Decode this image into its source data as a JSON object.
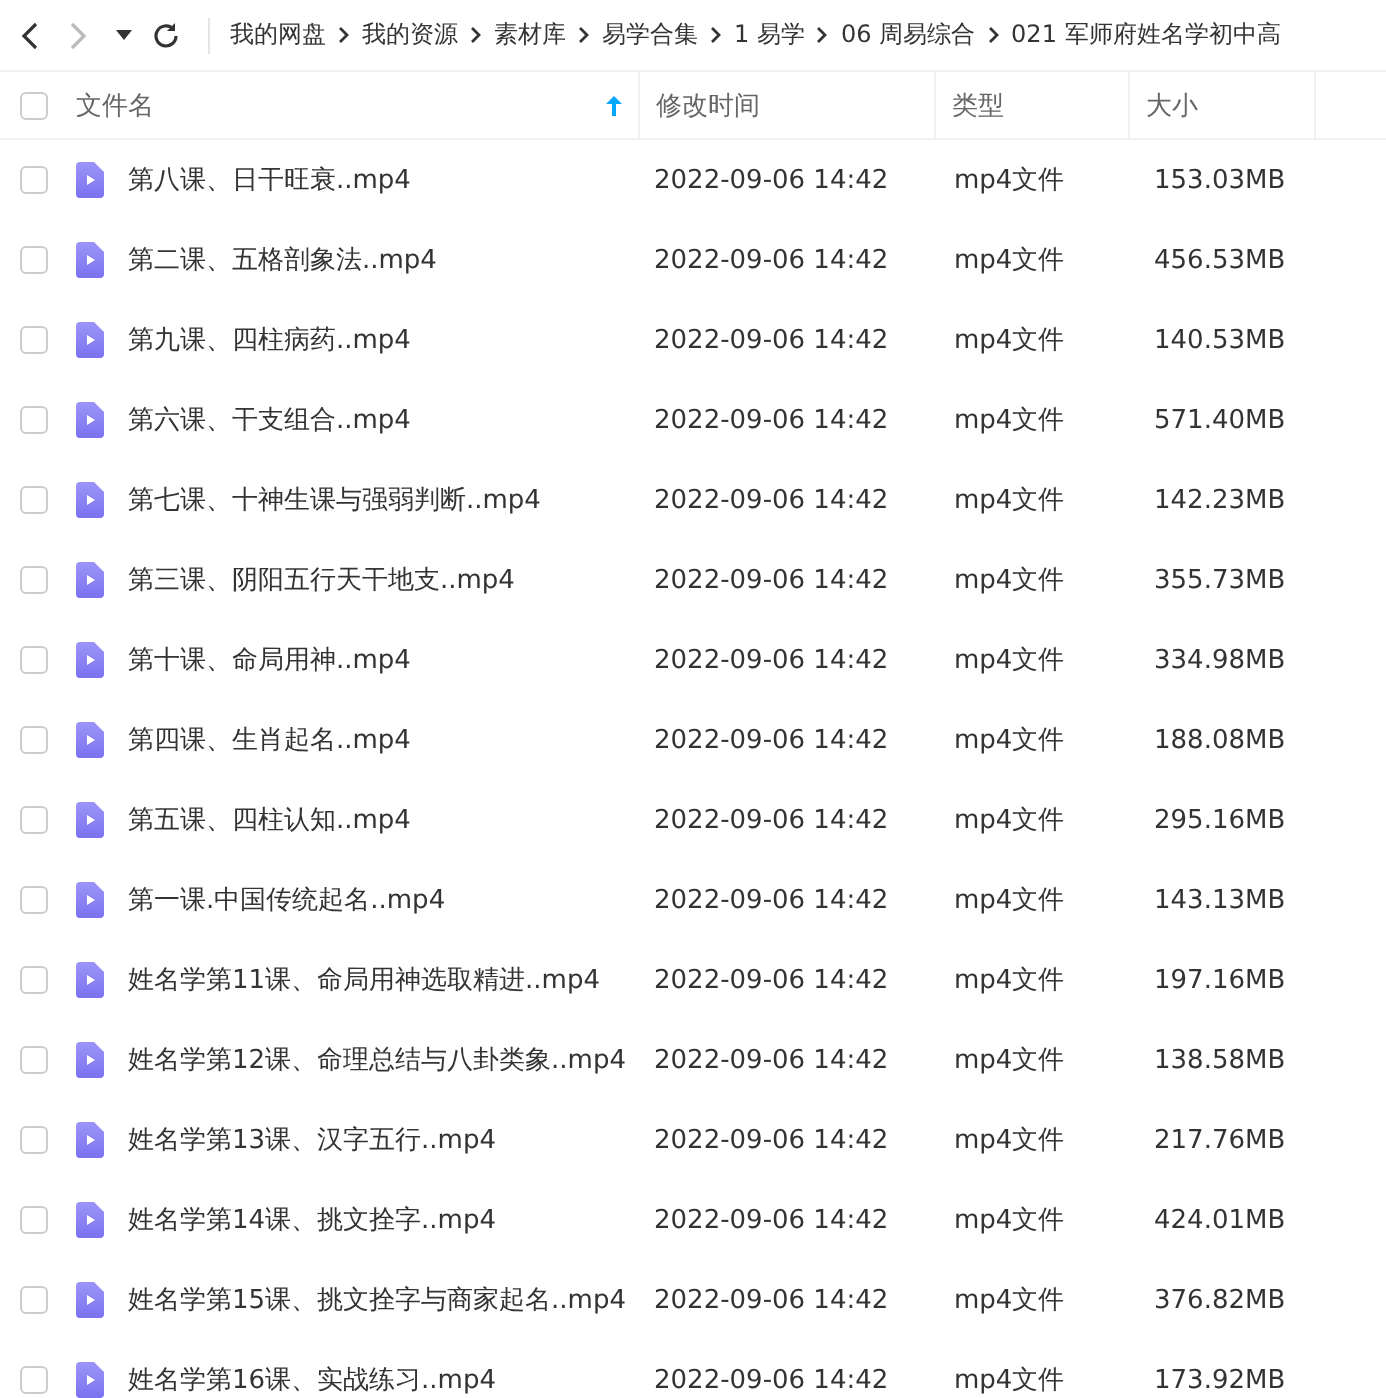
{
  "toolbar": {
    "breadcrumb": [
      "我的网盘",
      "我的资源",
      "素材库",
      "易学合集",
      "1 易学",
      "06 周易综合",
      "021 军师府姓名学初中高"
    ]
  },
  "table": {
    "all_checked": false,
    "columns": [
      {
        "label": "文件名",
        "sorted": true
      },
      {
        "label": "修改时间",
        "sorted": false
      },
      {
        "label": "类型",
        "sorted": false
      },
      {
        "label": "大小",
        "sorted": false
      }
    ],
    "rows": [
      {
        "name": "第八课、日干旺衰..mp4",
        "modified": "2022-09-06 14:42",
        "type": "mp4文件",
        "size": "153.03MB",
        "checked": false
      },
      {
        "name": "第二课、五格剖象法..mp4",
        "modified": "2022-09-06 14:42",
        "type": "mp4文件",
        "size": "456.53MB",
        "checked": false
      },
      {
        "name": "第九课、四柱病药..mp4",
        "modified": "2022-09-06 14:42",
        "type": "mp4文件",
        "size": "140.53MB",
        "checked": false
      },
      {
        "name": "第六课、干支组合..mp4",
        "modified": "2022-09-06 14:42",
        "type": "mp4文件",
        "size": "571.40MB",
        "checked": false
      },
      {
        "name": "第七课、十神生课与强弱判断..mp4",
        "modified": "2022-09-06 14:42",
        "type": "mp4文件",
        "size": "142.23MB",
        "checked": false
      },
      {
        "name": "第三课、阴阳五行天干地支..mp4",
        "modified": "2022-09-06 14:42",
        "type": "mp4文件",
        "size": "355.73MB",
        "checked": false
      },
      {
        "name": "第十课、命局用神..mp4",
        "modified": "2022-09-06 14:42",
        "type": "mp4文件",
        "size": "334.98MB",
        "checked": false
      },
      {
        "name": "第四课、生肖起名..mp4",
        "modified": "2022-09-06 14:42",
        "type": "mp4文件",
        "size": "188.08MB",
        "checked": false
      },
      {
        "name": "第五课、四柱认知..mp4",
        "modified": "2022-09-06 14:42",
        "type": "mp4文件",
        "size": "295.16MB",
        "checked": false
      },
      {
        "name": "第一课.中国传统起名..mp4",
        "modified": "2022-09-06 14:42",
        "type": "mp4文件",
        "size": "143.13MB",
        "checked": false
      },
      {
        "name": "姓名学第11课、命局用神选取精进..mp4",
        "modified": "2022-09-06 14:42",
        "type": "mp4文件",
        "size": "197.16MB",
        "checked": false
      },
      {
        "name": "姓名学第12课、命理总结与八卦类象..mp4",
        "modified": "2022-09-06 14:42",
        "type": "mp4文件",
        "size": "138.58MB",
        "checked": false
      },
      {
        "name": "姓名学第13课、汉字五行..mp4",
        "modified": "2022-09-06 14:42",
        "type": "mp4文件",
        "size": "217.76MB",
        "checked": false
      },
      {
        "name": "姓名学第14课、挑文拴字..mp4",
        "modified": "2022-09-06 14:42",
        "type": "mp4文件",
        "size": "424.01MB",
        "checked": false
      },
      {
        "name": "姓名学第15课、挑文拴字与商家起名..mp4",
        "modified": "2022-09-06 14:42",
        "type": "mp4文件",
        "size": "376.82MB",
        "checked": false
      },
      {
        "name": "姓名学第16课、实战练习..mp4",
        "modified": "2022-09-06 14:42",
        "type": "mp4文件",
        "size": "173.92MB",
        "checked": false
      }
    ]
  }
}
